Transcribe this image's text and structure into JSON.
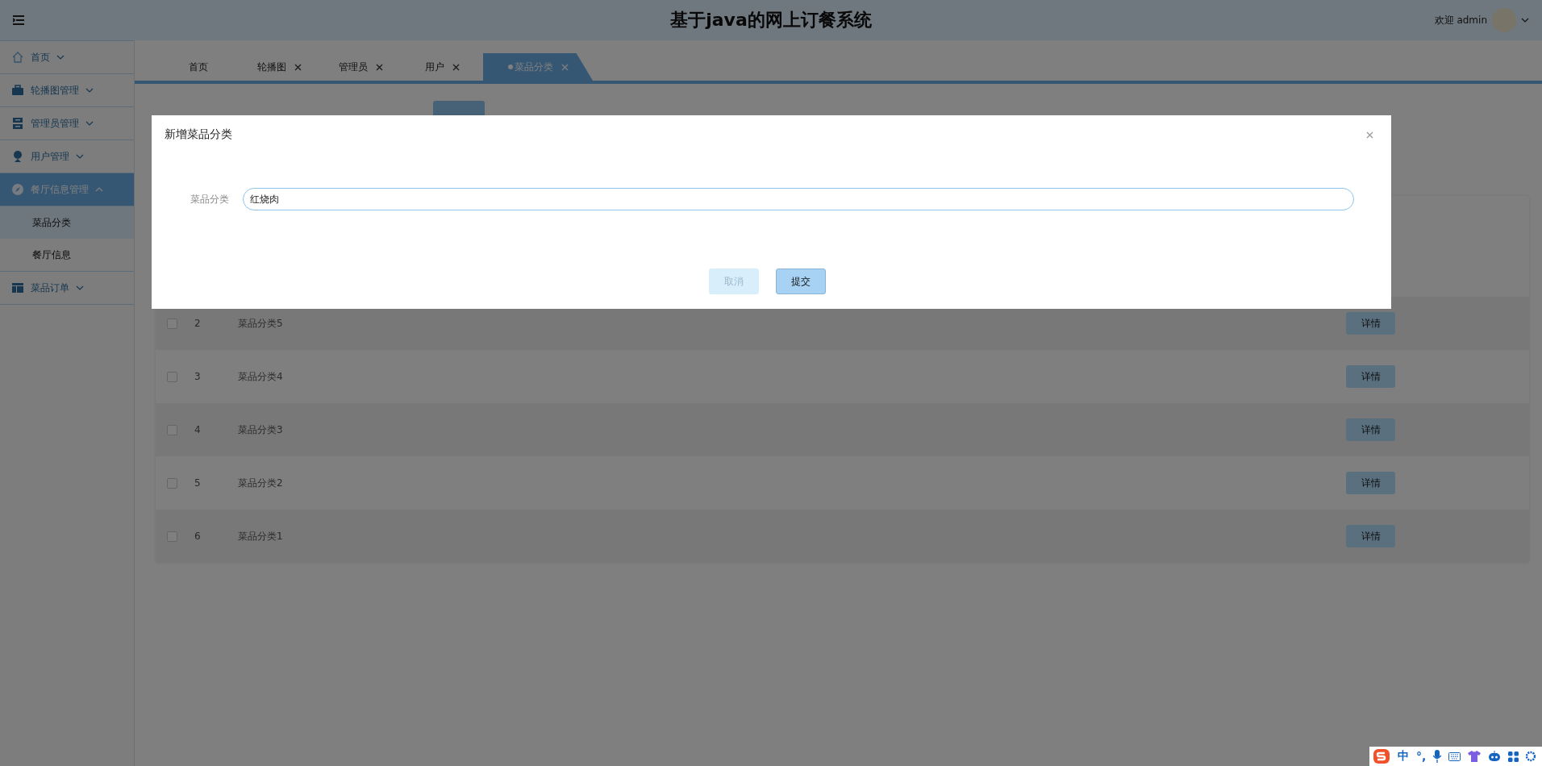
{
  "header": {
    "title": "基于java的网上订餐系统",
    "welcome": "欢迎 admin"
  },
  "sidebar": {
    "items": [
      {
        "label": "首页",
        "expanded": false,
        "selected": false
      },
      {
        "label": "轮播图管理",
        "expanded": false,
        "selected": false
      },
      {
        "label": "管理员管理",
        "expanded": false,
        "selected": false
      },
      {
        "label": "用户管理",
        "expanded": false,
        "selected": false
      },
      {
        "label": "餐厅信息管理",
        "expanded": true,
        "selected": true,
        "children": [
          {
            "label": "菜品分类",
            "selected": true
          },
          {
            "label": "餐厅信息",
            "selected": false
          }
        ]
      },
      {
        "label": "菜品订单",
        "expanded": false,
        "selected": false
      }
    ]
  },
  "tabs": [
    {
      "label": "首页",
      "closable": false,
      "selected": false
    },
    {
      "label": "轮播图",
      "closable": true,
      "selected": false
    },
    {
      "label": "管理员",
      "closable": true,
      "selected": false
    },
    {
      "label": "用户",
      "closable": true,
      "selected": false
    },
    {
      "label": "菜品分类",
      "closable": true,
      "selected": true
    }
  ],
  "table": {
    "rows": [
      {
        "checked": false,
        "index": "2",
        "name": "菜品分类5",
        "action": "详情"
      },
      {
        "checked": false,
        "index": "3",
        "name": "菜品分类4",
        "action": "详情"
      },
      {
        "checked": false,
        "index": "4",
        "name": "菜品分类3",
        "action": "详情"
      },
      {
        "checked": false,
        "index": "5",
        "name": "菜品分类2",
        "action": "详情"
      },
      {
        "checked": false,
        "index": "6",
        "name": "菜品分类1",
        "action": "详情"
      }
    ]
  },
  "dialog": {
    "title": "新增菜品分类",
    "field_label": "菜品分类",
    "field_value": "红烧肉",
    "cancel": "取消",
    "submit": "提交"
  },
  "ime": {
    "mode": "中",
    "punctuation": "°,"
  }
}
